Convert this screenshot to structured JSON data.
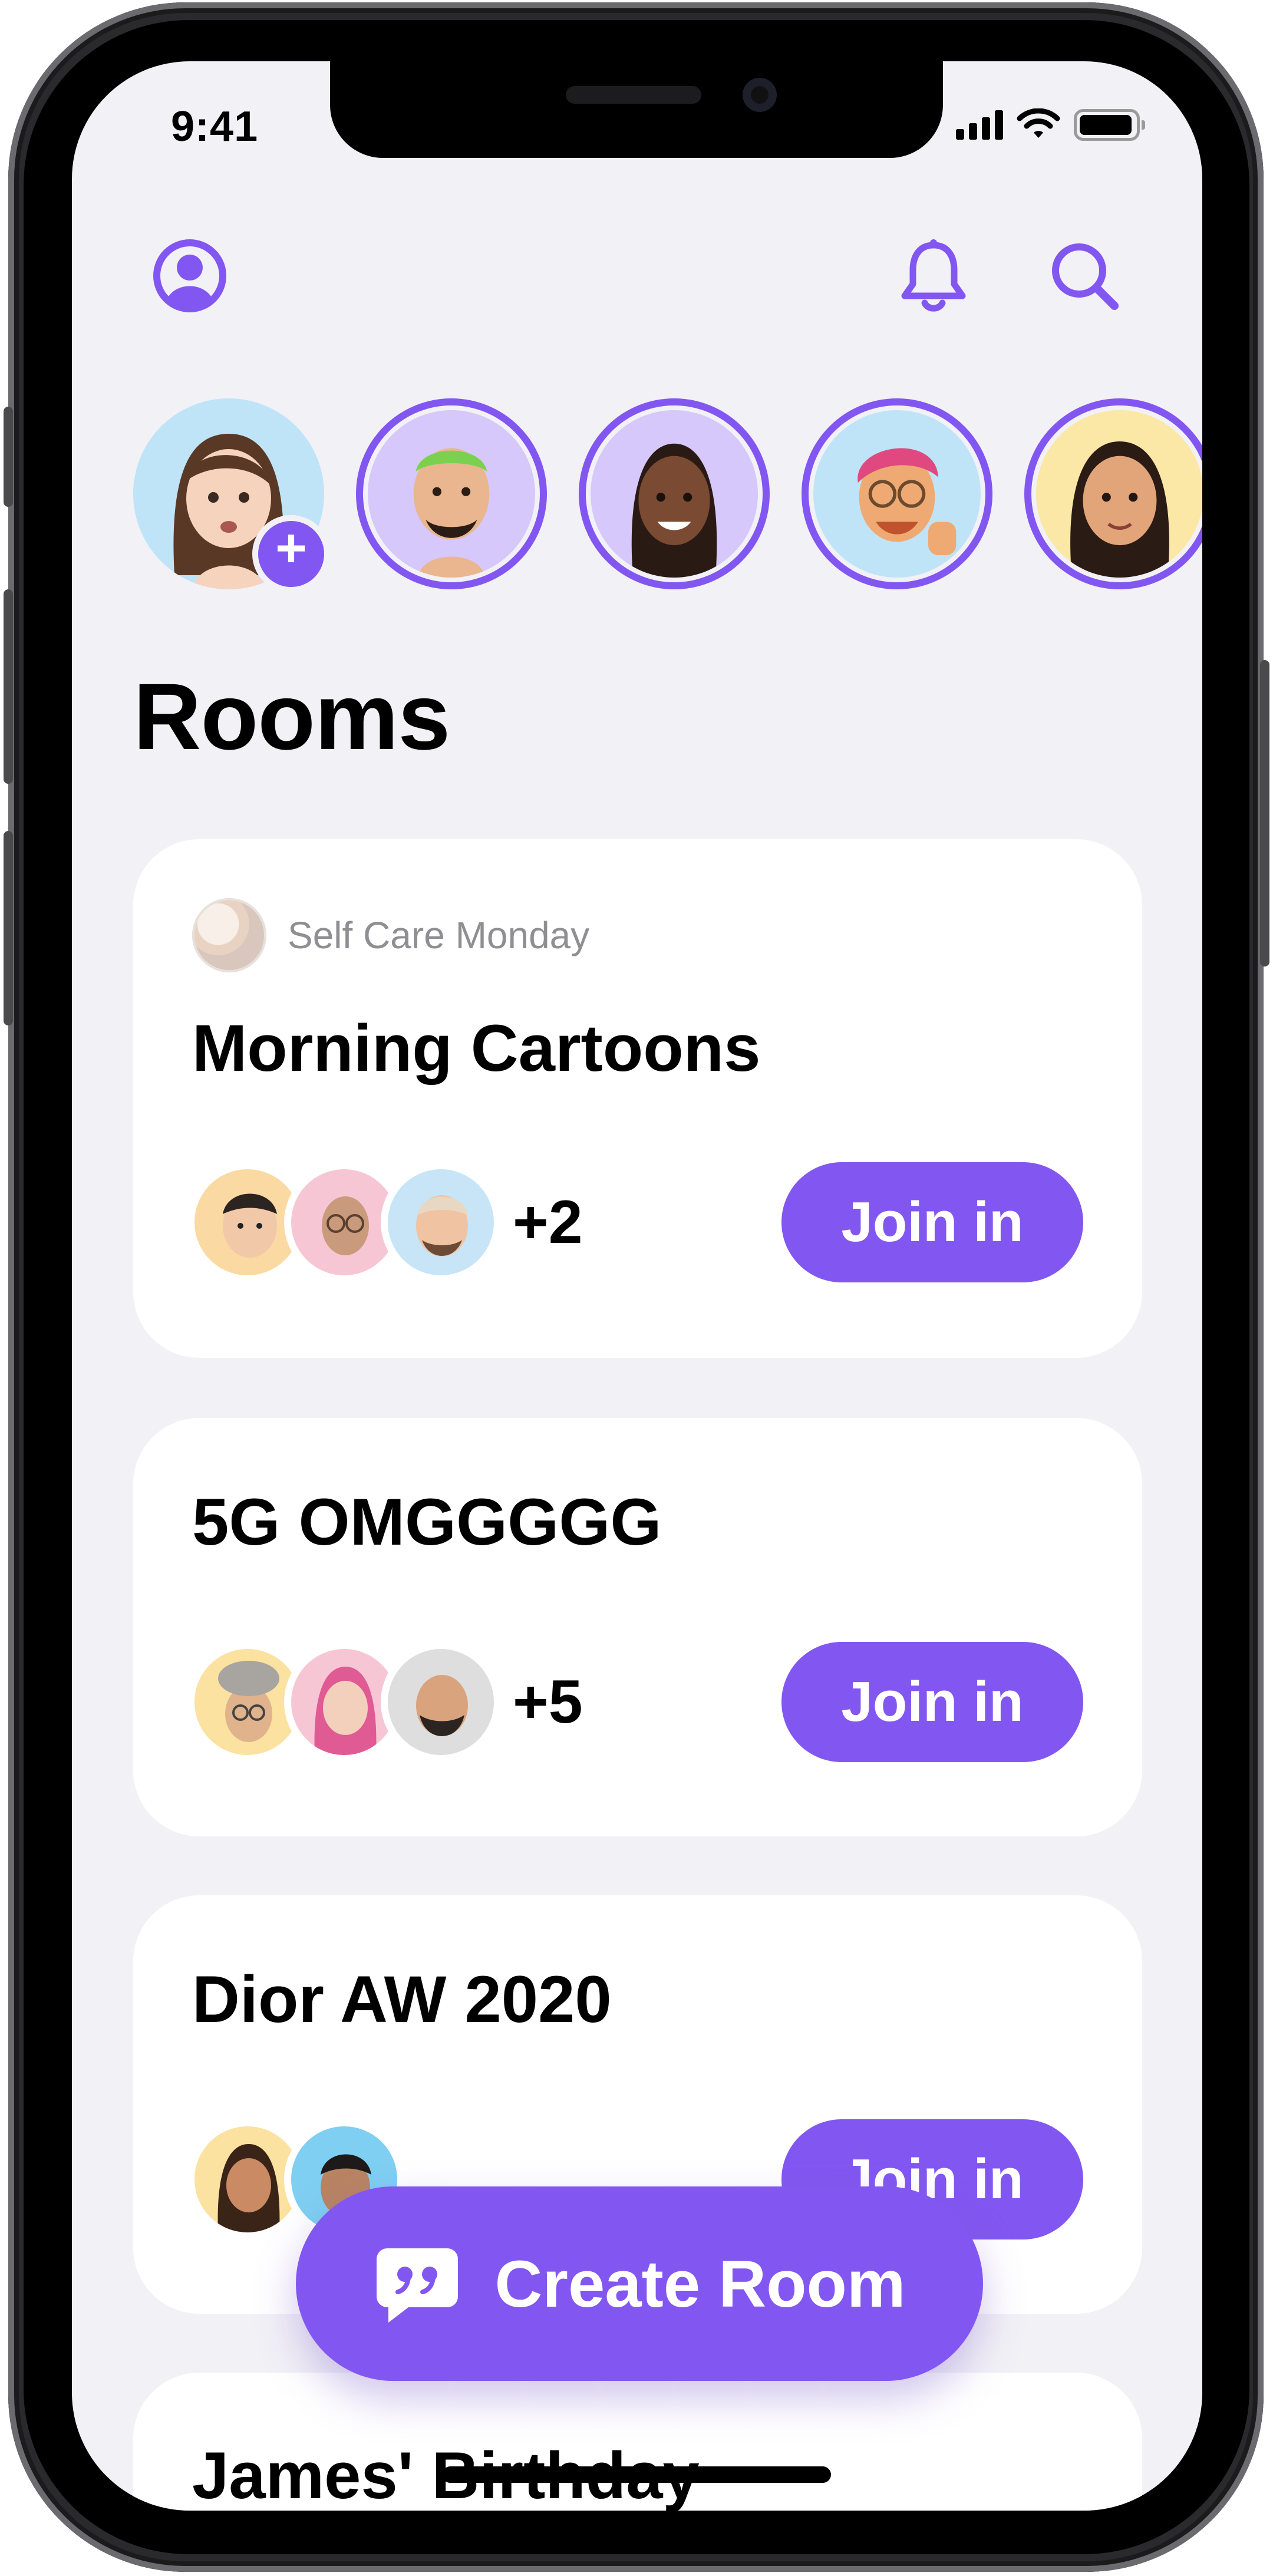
{
  "status_bar": {
    "time": "9:41"
  },
  "header": {
    "profile_icon": "person-circle-icon",
    "notifications_icon": "bell-icon",
    "search_icon": "search-icon"
  },
  "stories": [
    {
      "name": "my-story",
      "bg": "#bfe4f7",
      "has_add": true
    },
    {
      "name": "story-2",
      "bg": "#d6c8fb"
    },
    {
      "name": "story-3",
      "bg": "#d6c8fb"
    },
    {
      "name": "story-4",
      "bg": "#bfe4f7"
    },
    {
      "name": "story-5",
      "bg": "#fbe8a6"
    }
  ],
  "page": {
    "title": "Rooms"
  },
  "rooms": [
    {
      "club": "Self Care Monday",
      "title": "Morning Cartoons",
      "more": "+2",
      "join": "Join in",
      "avatar_colors": [
        "#fbd9a2",
        "#f7c6d5",
        "#c7e5f7"
      ]
    },
    {
      "club": "",
      "title": "5G OMGGGGG",
      "more": "+5",
      "join": "Join in",
      "avatar_colors": [
        "#fbe2a0",
        "#f7c6d5",
        "#dedede"
      ]
    },
    {
      "club": "",
      "title": "Dior AW 2020",
      "more": "",
      "join": "Join in",
      "avatar_colors": [
        "#fbe2a0",
        "#7fcff2"
      ]
    },
    {
      "club": "",
      "title": "James' Birthday"
    }
  ],
  "create_room": {
    "label": "Create Room",
    "icon": "quote-bubble-icon"
  },
  "colors": {
    "accent": "#8257f1",
    "background": "#f2f1f6",
    "card": "#ffffff"
  }
}
